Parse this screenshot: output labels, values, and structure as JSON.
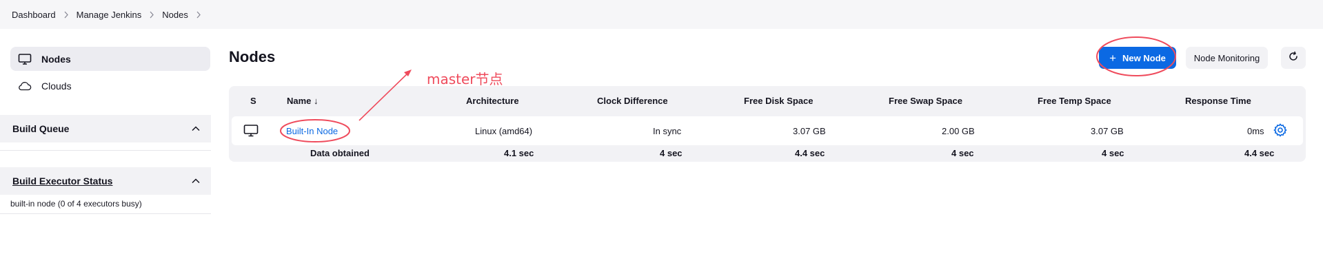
{
  "breadcrumb": [
    "Dashboard",
    "Manage Jenkins",
    "Nodes"
  ],
  "sidebar": {
    "items": [
      {
        "label": "Nodes",
        "icon": "computer-icon",
        "active": true
      },
      {
        "label": "Clouds",
        "icon": "cloud-icon",
        "active": false
      }
    ],
    "build_queue": {
      "title": "Build Queue"
    },
    "executor_status": {
      "title": "Build Executor Status",
      "text": "built-in node (0 of 4 executors busy)"
    }
  },
  "main": {
    "title": "Nodes",
    "new_node_label": "New Node",
    "monitoring_label": "Node Monitoring",
    "table": {
      "headers": [
        "S",
        "Name ↓",
        "Architecture",
        "Clock Difference",
        "Free Disk Space",
        "Free Swap Space",
        "Free Temp Space",
        "Response Time"
      ],
      "row": {
        "name": "Built-In Node",
        "architecture": "Linux (amd64)",
        "clock": "In sync",
        "disk": "3.07 GB",
        "swap": "2.00 GB",
        "temp": "3.07 GB",
        "response": "0ms"
      },
      "footer": {
        "label": "Data obtained",
        "architecture": "4.1 sec",
        "clock": "4 sec",
        "disk": "4.4 sec",
        "swap": "4 sec",
        "temp": "4 sec",
        "response": "4.4 sec"
      }
    }
  },
  "annotation": {
    "label": "master节点",
    "color": "#ef4b5c"
  },
  "colors": {
    "accent": "#0b69e3",
    "annotation": "#ef4b5c"
  }
}
